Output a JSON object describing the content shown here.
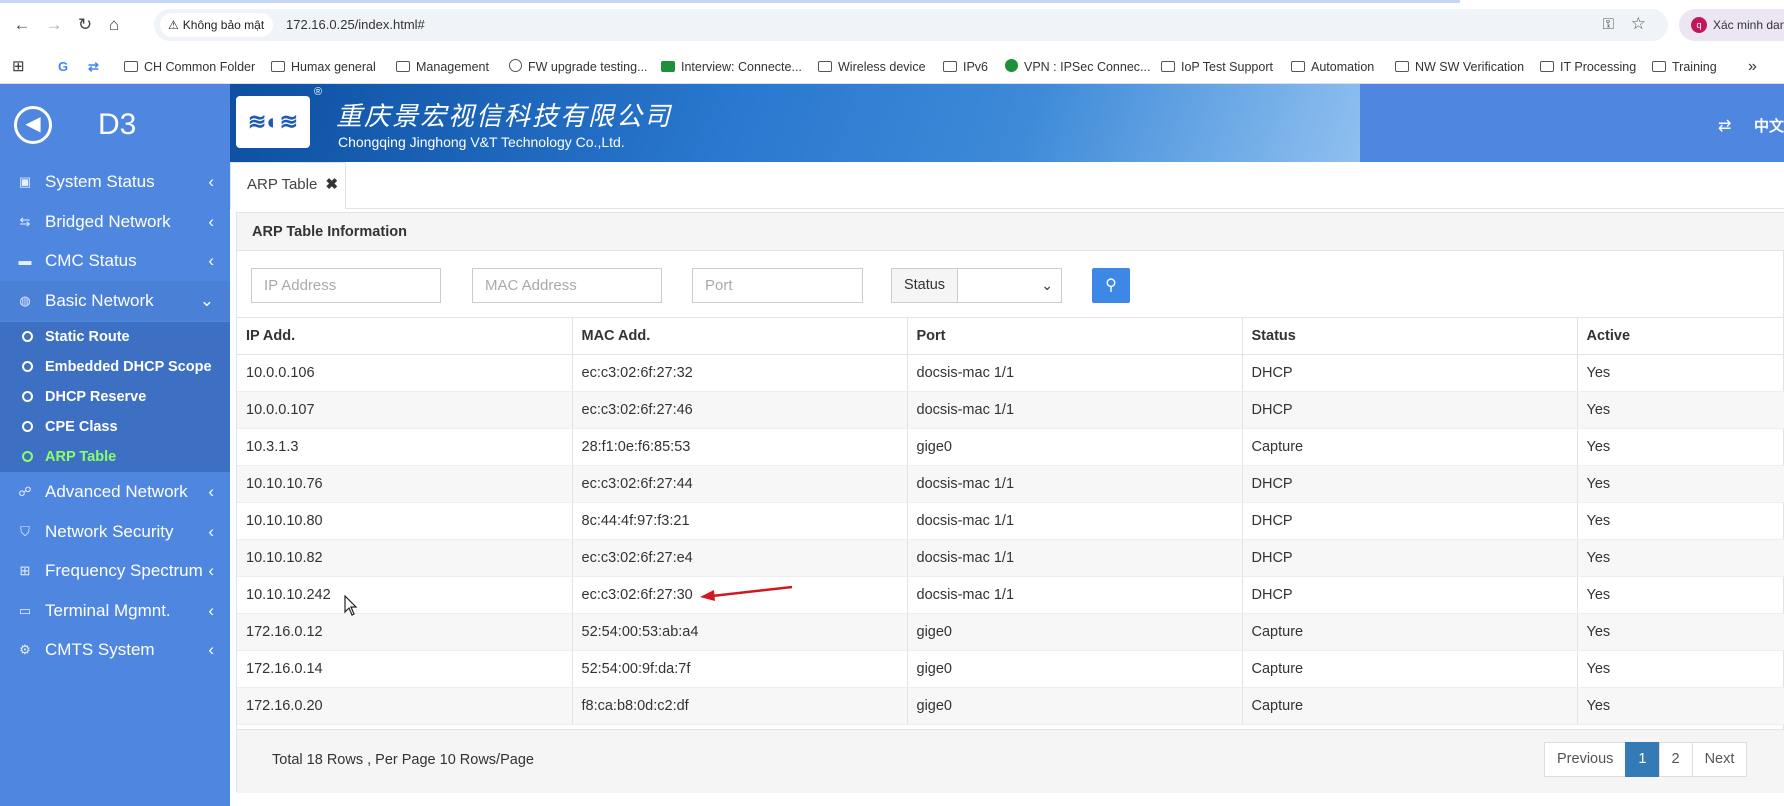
{
  "browser": {
    "security_label": "Không bảo mật",
    "url": "172.16.0.25/index.html#",
    "profile_label": "Xác minh danh",
    "bookmarks": [
      "CH Common Folder",
      "Humax general",
      "Management",
      "FW upgrade testing...",
      "Interview: Connecte...",
      "Wireless device",
      "IPv6",
      "VPN : IPSec Connec...",
      "IoP Test Support",
      "Automation",
      "NW SW Verification",
      "IT Processing",
      "Training"
    ],
    "more": "»"
  },
  "header": {
    "brand": "D3",
    "company_cn": "重庆景宏视信科技有限公司",
    "company_en": "Chongqing Jinghong V&T Technology Co.,Ltd.",
    "lang": "中文"
  },
  "sidebar": {
    "menus": [
      "System Status",
      "Bridged Network",
      "CMC Status",
      "Basic Network",
      "Advanced Network",
      "Network Security",
      "Frequency Spectrum",
      "Terminal Mgmnt.",
      "CMTS System"
    ],
    "submenu": [
      "Static Route",
      "Embedded DHCP Scope",
      "DHCP Reserve",
      "CPE Class",
      "ARP Table"
    ]
  },
  "tab": {
    "label": "ARP Table",
    "close": "✖"
  },
  "panel": {
    "title": "ARP Table Information",
    "filters": {
      "ip_placeholder": "IP Address",
      "mac_placeholder": "MAC Address",
      "port_placeholder": "Port",
      "status_label": "Status"
    }
  },
  "table": {
    "headers": [
      "IP Add.",
      "MAC Add.",
      "Port",
      "Status",
      "Active"
    ],
    "rows": [
      [
        "10.0.0.106",
        "ec:c3:02:6f:27:32",
        "docsis-mac 1/1",
        "DHCP",
        "Yes"
      ],
      [
        "10.0.0.107",
        "ec:c3:02:6f:27:46",
        "docsis-mac 1/1",
        "DHCP",
        "Yes"
      ],
      [
        "10.3.1.3",
        "28:f1:0e:f6:85:53",
        "gige0",
        "Capture",
        "Yes"
      ],
      [
        "10.10.10.76",
        "ec:c3:02:6f:27:44",
        "docsis-mac 1/1",
        "DHCP",
        "Yes"
      ],
      [
        "10.10.10.80",
        "8c:44:4f:97:f3:21",
        "docsis-mac 1/1",
        "DHCP",
        "Yes"
      ],
      [
        "10.10.10.82",
        "ec:c3:02:6f:27:e4",
        "docsis-mac 1/1",
        "DHCP",
        "Yes"
      ],
      [
        "10.10.10.242",
        "ec:c3:02:6f:27:30",
        "docsis-mac 1/1",
        "DHCP",
        "Yes"
      ],
      [
        "172.16.0.12",
        "52:54:00:53:ab:a4",
        "gige0",
        "Capture",
        "Yes"
      ],
      [
        "172.16.0.14",
        "52:54:00:9f:da:7f",
        "gige0",
        "Capture",
        "Yes"
      ],
      [
        "172.16.0.20",
        "f8:ca:b8:0d:c2:df",
        "gige0",
        "Capture",
        "Yes"
      ]
    ]
  },
  "footer": {
    "total": "Total 18 Rows , Per Page 10 Rows/Page",
    "pager": {
      "previous": "Previous",
      "page1": "1",
      "page2": "2",
      "next": "Next"
    }
  },
  "colors": {
    "sidebar": "#4f86e0",
    "submenu": "#3d6fc3",
    "active_item": "#8bff6a",
    "annotation_arrow": "#d0191f",
    "primary_button": "#3d87e6"
  }
}
